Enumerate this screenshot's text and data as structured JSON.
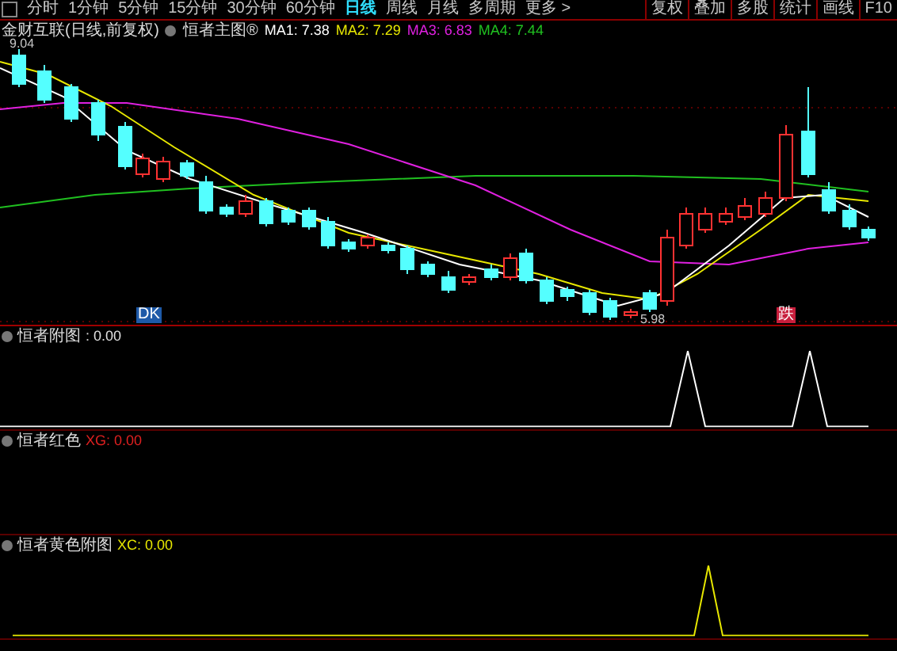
{
  "toolbar": {
    "periods": [
      {
        "label": "分时",
        "selected": false
      },
      {
        "label": "1分钟",
        "selected": false
      },
      {
        "label": "5分钟",
        "selected": false
      },
      {
        "label": "15分钟",
        "selected": false
      },
      {
        "label": "30分钟",
        "selected": false
      },
      {
        "label": "60分钟",
        "selected": false
      },
      {
        "label": "日线",
        "selected": true
      },
      {
        "label": "周线",
        "selected": false
      },
      {
        "label": "月线",
        "selected": false
      },
      {
        "label": "多周期",
        "selected": false
      },
      {
        "label": "更多 >",
        "selected": false
      }
    ],
    "buttons": [
      "复权",
      "叠加",
      "多股",
      "统计",
      "画线",
      "F10"
    ]
  },
  "main_chart": {
    "title": "金财互联(日线,前复权)",
    "indicator": "恒者主图®",
    "averages": [
      {
        "label": "MA1: 7.38",
        "color": "#ffffff"
      },
      {
        "label": "MA2: 7.29",
        "color": "#e8e800"
      },
      {
        "label": "MA3: 6.83",
        "color": "#e020e0"
      },
      {
        "label": "MA4: 7.44",
        "color": "#20c020"
      }
    ],
    "price_labels": [
      {
        "text": "9.04",
        "kind": "high"
      },
      {
        "text": "5.98",
        "kind": "low"
      }
    ],
    "markers": [
      {
        "text": "DK",
        "kind": "buy"
      },
      {
        "text": "跌",
        "kind": "sell"
      }
    ]
  },
  "panels": [
    {
      "title": "恒者附图",
      "value": ": 0.00",
      "color": "#e0e0e0"
    },
    {
      "title": "恒者红色",
      "value": "XG: 0.00",
      "color": "#e02020"
    },
    {
      "title": "恒者黄色附图",
      "value": "XC: 0.00",
      "color": "#e8e800"
    }
  ]
}
